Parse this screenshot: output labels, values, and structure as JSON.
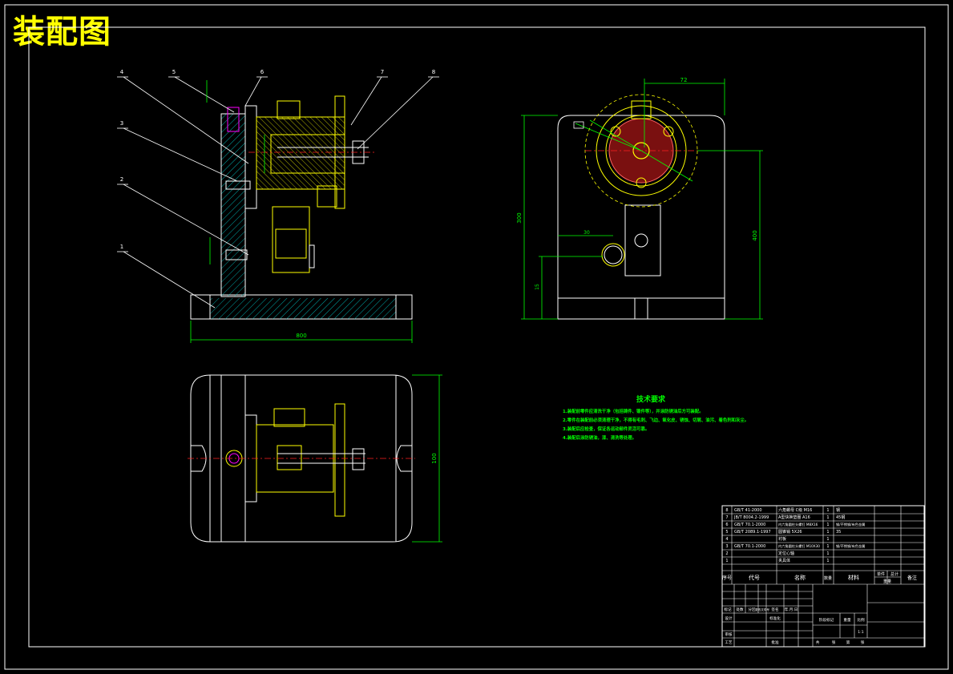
{
  "title": "装配图",
  "balloons": [
    "4",
    "5",
    "6",
    "7",
    "8",
    "3",
    "2",
    "1"
  ],
  "dimensions": {
    "front_width": "800",
    "side_width": "72",
    "side_height_left": "300",
    "side_height_right": "400",
    "side_offset": "30",
    "side_small": "15",
    "top_height": "100"
  },
  "tech_requirements": {
    "heading": "技术要求",
    "lines": [
      "1.装配前零件应清洗干净（包括铸件、锻件等），并涂防锈油后方可装配。",
      "2.零件在装配前必须清理干净，不得有毛刺、飞边、氧化皮、锈蚀、切屑、油污、着色剂和灰尘。",
      "3.装配后应检查，保证各运动部件灵活可靠。",
      "4.装配后涂防锈油，漆、清洗等处理。"
    ]
  },
  "bom": {
    "rows": [
      {
        "no": "8",
        "code": "GB/T 41-2000",
        "name": "六角螺母 C级 M16",
        "qty": "1",
        "material": "钢"
      },
      {
        "no": "7",
        "code": "JB/T 8004.2-1999",
        "name": "A型快换垫圈 A16",
        "qty": "1",
        "material": "45钢"
      },
      {
        "no": "6",
        "code": "GB/T 70.1-2000",
        "name": "内六角圆柱头螺钉 M8X16",
        "qty": "1",
        "material": "钢/不锈钢/有色金属"
      },
      {
        "no": "5",
        "code": "GB/T 2089.1-1997",
        "name": "圆锥销 5X26",
        "qty": "1",
        "material": "35"
      },
      {
        "no": "4",
        "code": "",
        "name": "衬板",
        "qty": "1",
        "material": ""
      },
      {
        "no": "3",
        "code": "GB/T 70.1-2000",
        "name": "内六角圆柱头螺钉 M10X30",
        "qty": "1",
        "material": "钢/不锈钢/有色金属"
      },
      {
        "no": "2",
        "code": "",
        "name": "定位心轴",
        "qty": "1",
        "material": ""
      },
      {
        "no": "1",
        "code": "",
        "name": "夹具体",
        "qty": "1",
        "material": ""
      }
    ],
    "header": {
      "no": "序号",
      "code": "代号",
      "name": "名称",
      "qty": "数量",
      "material": "材料",
      "unit_weight": "单件",
      "total_weight": "总计",
      "weight": "重量",
      "remarks": "备注"
    },
    "sign_labels": [
      "标记",
      "处数",
      "分区",
      "更改文件号",
      "签名",
      "年.月.日"
    ],
    "role_labels": [
      "设计",
      "审核",
      "工艺"
    ],
    "standardize": "标准化",
    "approve": "批准",
    "stage_labels": [
      "阶段标记",
      "重量",
      "比例"
    ],
    "scale": "1:1",
    "sheet_labels": [
      "共",
      "张",
      "第",
      "张"
    ]
  }
}
